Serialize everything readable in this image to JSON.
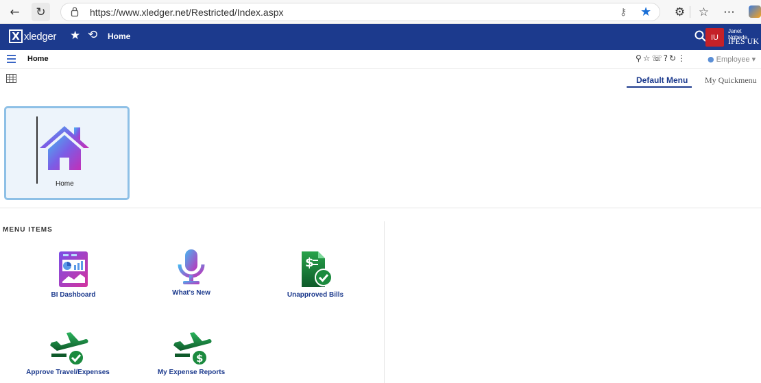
{
  "browser": {
    "url": "https://www.xledger.net/Restricted/Index.aspx",
    "back_icon": "arrow-left",
    "refresh_icon": "refresh",
    "accent": "#1a6fd6"
  },
  "app": {
    "logo_text": "xledger",
    "logo_mark": "X",
    "breadcrumb": "Home",
    "header_color": "#1c3a8d",
    "user": {
      "initials": "IU",
      "name": "Janet Ngbede",
      "org": "IFES UK",
      "avatar_color": "#c42128"
    }
  },
  "subheader": {
    "title": "Home",
    "role": "Employee",
    "role_caret": "▾"
  },
  "tabs": {
    "default_menu": "Default Menu",
    "quickmenu": "My Quickmenu"
  },
  "tile": {
    "label": "Home"
  },
  "menu": {
    "section_title": "MENU ITEMS",
    "items": [
      {
        "label": "BI Dashboard",
        "icon": "dashboard-icon"
      },
      {
        "label": "What's New",
        "icon": "microphone-icon"
      },
      {
        "label": "Unapproved Bills",
        "icon": "bill-check-icon"
      },
      {
        "label": "Approve Travel/Expenses",
        "icon": "plane-check-icon"
      },
      {
        "label": "My Expense Reports",
        "icon": "plane-dollar-icon"
      }
    ]
  }
}
